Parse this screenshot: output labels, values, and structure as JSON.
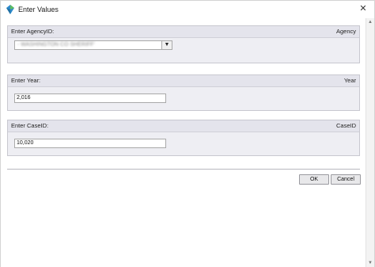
{
  "window": {
    "title": "Enter Values",
    "close_glyph": "✕"
  },
  "agency_section": {
    "label": "Enter AgencyID:",
    "right_label": "Agency",
    "selected_value": "-  WASHINGTON CO SHERIFF'",
    "arrow_glyph": "▼"
  },
  "year_section": {
    "label": "Enter Year:",
    "right_label": "Year",
    "value": "2,016"
  },
  "case_section": {
    "label": "Enter CaseID:",
    "right_label": "CaseID",
    "value": "10,020"
  },
  "buttons": {
    "ok_label": "OK",
    "cancel_label": "Cancel"
  },
  "scrollbar": {
    "up_glyph": "▲",
    "down_glyph": "▼"
  },
  "icons": {
    "app": "app-icon",
    "close": "close-icon",
    "dropdown": "chevron-down-icon"
  }
}
